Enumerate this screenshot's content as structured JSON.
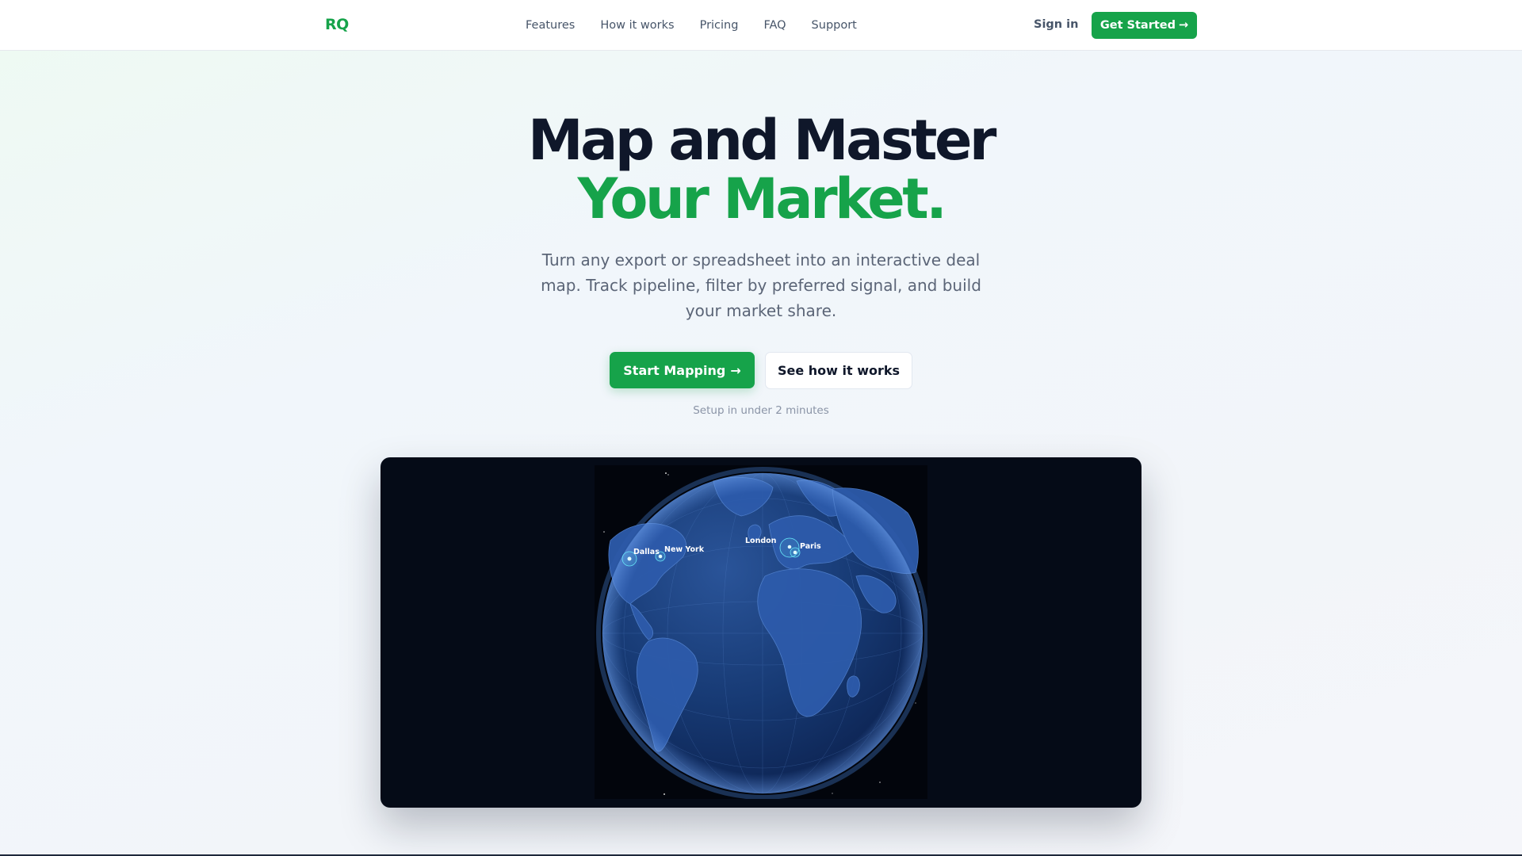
{
  "nav": {
    "logo": "RQ",
    "links": [
      "Features",
      "How it works",
      "Pricing",
      "FAQ",
      "Support"
    ],
    "signin": "Sign in",
    "cta": "Get Started",
    "cta_arrow": "→"
  },
  "hero": {
    "title_line1": "Map and Master",
    "title_line2": "Your Market.",
    "subtitle": "Turn any export or spreadsheet into an interactive deal map. Track pipeline, filter by preferred signal, and build your market share.",
    "primary_button": "Start Mapping",
    "primary_arrow": "→",
    "secondary_button": "See how it works",
    "setup_note": "Setup in under 2 minutes"
  },
  "map": {
    "cities": [
      "Dallas",
      "New York",
      "London",
      "Paris"
    ]
  },
  "colors": {
    "accent": "#16a34a",
    "heading": "#0f172a",
    "map_background": "#050b17",
    "globe": "#1c3f7a",
    "marker": "#67e8f9"
  }
}
